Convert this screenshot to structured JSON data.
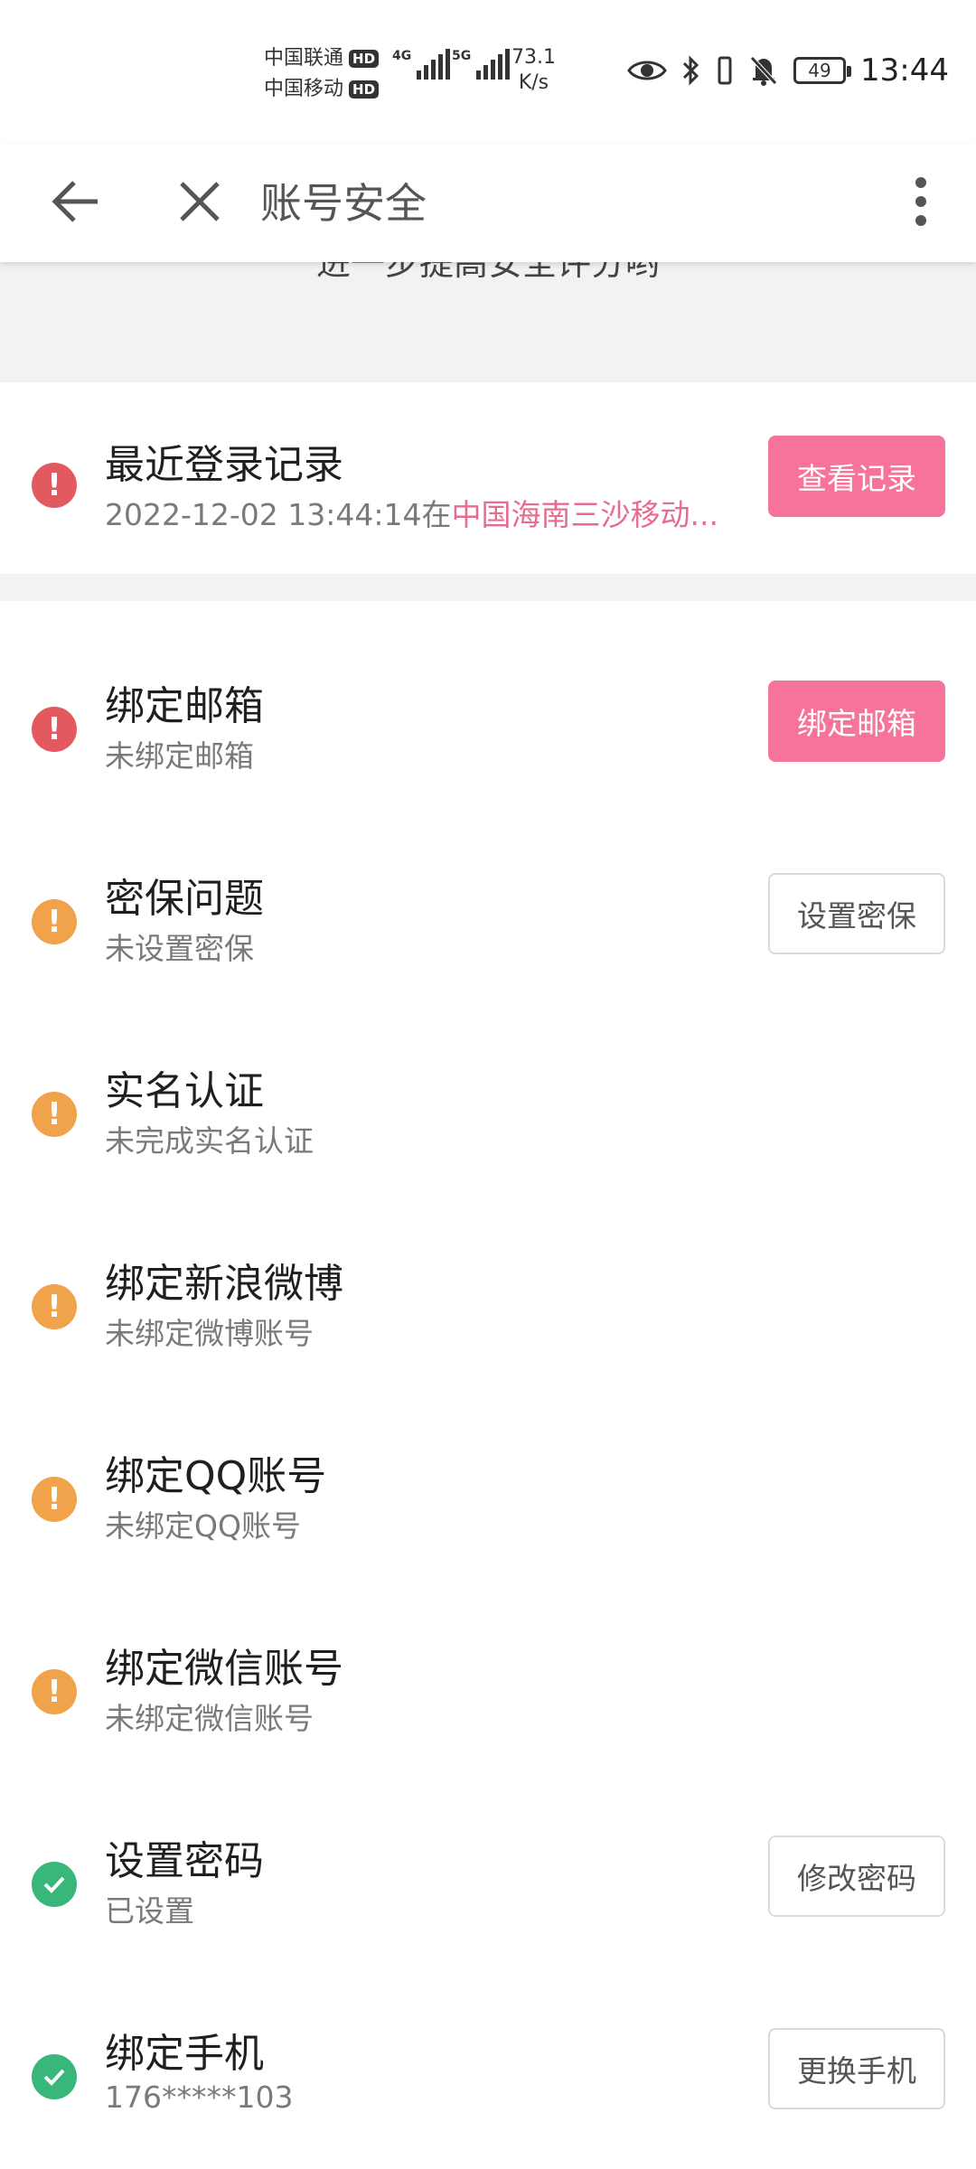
{
  "status_bar": {
    "carrier1": "中国联通",
    "carrier2": "中国移动",
    "hd": "HD",
    "net1": "4G",
    "net2": "5G",
    "speed_value": "73.1",
    "speed_unit": "K/s",
    "battery": "49",
    "time": "13:44"
  },
  "app_bar": {
    "title": "账号安全"
  },
  "banner": {
    "text": "进一步提高安全评分哟"
  },
  "login_record": {
    "title": "最近登录记录",
    "timestamp": "2022-12-02 13:44:14在",
    "location": "中国海南三沙移动...",
    "button": "查看记录"
  },
  "items": [
    {
      "title": "绑定邮箱",
      "subtitle": "未绑定邮箱",
      "status": "red",
      "button": "绑定邮箱",
      "button_style": "pink"
    },
    {
      "title": "密保问题",
      "subtitle": "未设置密保",
      "status": "orange",
      "button": "设置密保",
      "button_style": "outline"
    },
    {
      "title": "实名认证",
      "subtitle": "未完成实名认证",
      "status": "orange"
    },
    {
      "title": "绑定新浪微博",
      "subtitle": "未绑定微博账号",
      "status": "orange"
    },
    {
      "title": "绑定QQ账号",
      "subtitle": "未绑定QQ账号",
      "status": "orange"
    },
    {
      "title": "绑定微信账号",
      "subtitle": "未绑定微信账号",
      "status": "orange"
    },
    {
      "title": "设置密码",
      "subtitle": "已设置",
      "status": "green",
      "button": "修改密码",
      "button_style": "outline"
    },
    {
      "title": "绑定手机",
      "subtitle": "176*****103",
      "status": "green",
      "button": "更换手机",
      "button_style": "outline"
    }
  ],
  "colors": {
    "pink": "#f6749a",
    "red": "#e25a5f",
    "orange": "#f0a34a",
    "green": "#39b77a",
    "location": "#e56d8f"
  },
  "icons": {
    "back": "arrow-left-icon",
    "close": "close-icon",
    "more": "more-vertical-icon",
    "warn": "exclamation-icon",
    "ok": "check-icon"
  }
}
